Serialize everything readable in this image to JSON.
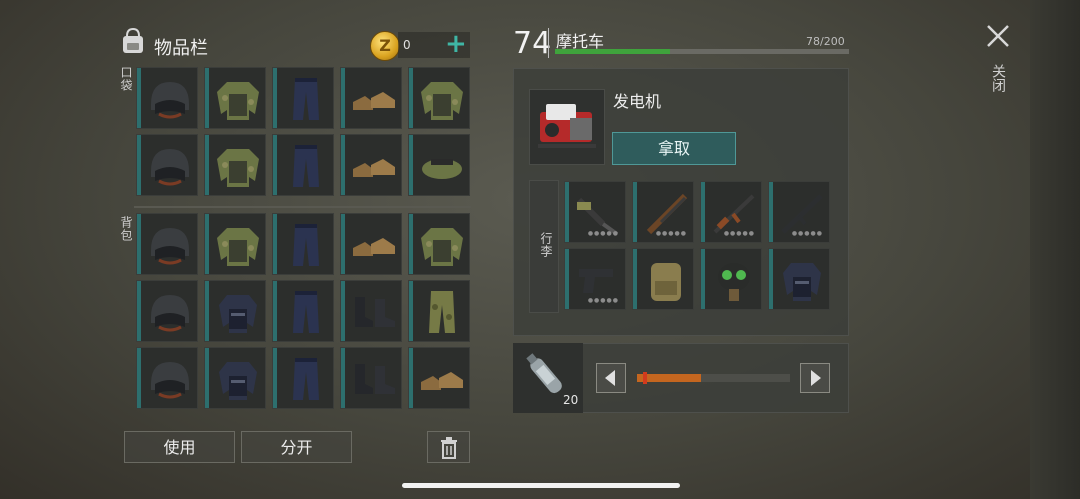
{
  "inventory": {
    "title": "物品栏",
    "coins": "0",
    "plus_icon": "plus-icon",
    "pocket_label": "口袋",
    "backpack_label": "背包",
    "pocket_rows": [
      [
        "helmet-icon",
        "camo-jacket-icon",
        "blue-pants-icon",
        "brown-shoes-icon",
        "camo-jacket-icon"
      ],
      [
        "helmet-icon",
        "camo-jacket-icon",
        "blue-pants-icon",
        "brown-shoes-icon",
        "camo-cap-icon"
      ]
    ],
    "backpack_rows": [
      [
        "helmet-icon",
        "camo-jacket-icon",
        "blue-pants-icon",
        "brown-shoes-icon",
        "camo-jacket-icon"
      ],
      [
        "helmet-icon",
        "tactical-vest-icon",
        "blue-pants-icon",
        "black-boots-icon",
        "camo-pants-icon"
      ],
      [
        "helmet-icon",
        "tactical-vest-icon",
        "blue-pants-icon",
        "black-boots-icon",
        "brown-shoes-icon"
      ]
    ],
    "use_label": "使用",
    "split_label": "分开"
  },
  "vehicle": {
    "level": "74",
    "name": "摩托车",
    "capacity_text": "78/200",
    "capacity_fraction": 0.39,
    "slot_label": "发电机",
    "take_label": "拿取",
    "cargo_label": "行李",
    "cargo_rows": [
      [
        "crossbow-icon",
        "shotgun-icon",
        "ak-rifle-icon",
        "assault-rifle-icon"
      ],
      [
        "pistol-icon",
        "military-backpack-icon",
        "gas-mask-icon",
        "tactical-vest-icon"
      ]
    ]
  },
  "ammo": {
    "item_icon": "water-bottle-icon",
    "count": "20",
    "slider_fraction": 0.42
  },
  "close_label": "关闭",
  "colors": {
    "accent": "#2d6f6e",
    "capacity_bar": "#3fa33c",
    "slider_fill": "#c4661f"
  }
}
